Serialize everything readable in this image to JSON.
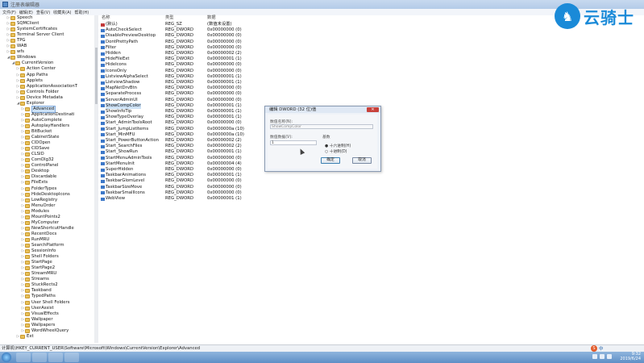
{
  "window": {
    "title": "注册表编辑器"
  },
  "menu": [
    "文件(F)",
    "编辑(E)",
    "查看(V)",
    "收藏夹(A)",
    "帮助(H)"
  ],
  "tree": {
    "items": [
      {
        "label": "Speech",
        "indent": 1,
        "expanded": false
      },
      {
        "label": "SQMClient",
        "indent": 1,
        "expanded": false
      },
      {
        "label": "SystemCertificates",
        "indent": 1,
        "expanded": false
      },
      {
        "label": "Terminal Server Client",
        "indent": 1,
        "expanded": false
      },
      {
        "label": "TPG",
        "indent": 1,
        "expanded": false
      },
      {
        "label": "WAB",
        "indent": 1,
        "expanded": false
      },
      {
        "label": "wfs",
        "indent": 1,
        "expanded": false
      },
      {
        "label": "Windows",
        "indent": 1,
        "expanded": true
      },
      {
        "label": "CurrentVersion",
        "indent": 2,
        "expanded": true
      },
      {
        "label": "Action Center",
        "indent": 3,
        "expanded": false
      },
      {
        "label": "App Paths",
        "indent": 3,
        "expanded": false
      },
      {
        "label": "Applets",
        "indent": 3,
        "expanded": false
      },
      {
        "label": "ApplicationAssociationT",
        "indent": 3,
        "expanded": false
      },
      {
        "label": "Controls Folder",
        "indent": 3,
        "expanded": false
      },
      {
        "label": "Device Metadata",
        "indent": 3,
        "expanded": false
      },
      {
        "label": "Explorer",
        "indent": 3,
        "expanded": true
      },
      {
        "label": "Advanced",
        "indent": 4,
        "expanded": false,
        "selected": true
      },
      {
        "label": "ApplicationDestinati",
        "indent": 4,
        "expanded": false
      },
      {
        "label": "AutoComplete",
        "indent": 4,
        "expanded": false
      },
      {
        "label": "AutoplayHandlers",
        "indent": 4,
        "expanded": false
      },
      {
        "label": "BitBucket",
        "indent": 4,
        "expanded": false
      },
      {
        "label": "CabinetState",
        "indent": 4,
        "expanded": false
      },
      {
        "label": "CIDOpen",
        "indent": 4,
        "expanded": false
      },
      {
        "label": "CIDSave",
        "indent": 4,
        "expanded": false
      },
      {
        "label": "CLSID",
        "indent": 4,
        "expanded": false
      },
      {
        "label": "ComDlg32",
        "indent": 4,
        "expanded": false
      },
      {
        "label": "ControlPanel",
        "indent": 4,
        "expanded": false
      },
      {
        "label": "Desktop",
        "indent": 4,
        "expanded": false
      },
      {
        "label": "Discardable",
        "indent": 4,
        "expanded": false
      },
      {
        "label": "FileExts",
        "indent": 4,
        "expanded": false
      },
      {
        "label": "FolderTypes",
        "indent": 4,
        "expanded": false
      },
      {
        "label": "HideDesktopIcons",
        "indent": 4,
        "expanded": false
      },
      {
        "label": "LowRegistry",
        "indent": 4,
        "expanded": false
      },
      {
        "label": "MenuOrder",
        "indent": 4,
        "expanded": false
      },
      {
        "label": "Modules",
        "indent": 4,
        "expanded": false
      },
      {
        "label": "MountPoints2",
        "indent": 4,
        "expanded": false
      },
      {
        "label": "MyComputer",
        "indent": 4,
        "expanded": false
      },
      {
        "label": "NewShortcutHandle",
        "indent": 4,
        "expanded": false
      },
      {
        "label": "RecentDocs",
        "indent": 4,
        "expanded": false
      },
      {
        "label": "RunMRU",
        "indent": 4,
        "expanded": false
      },
      {
        "label": "SearchPlatform",
        "indent": 4,
        "expanded": false
      },
      {
        "label": "SessionInfo",
        "indent": 4,
        "expanded": false
      },
      {
        "label": "Shell Folders",
        "indent": 4,
        "expanded": false
      },
      {
        "label": "StartPage",
        "indent": 4,
        "expanded": false
      },
      {
        "label": "StartPage2",
        "indent": 4,
        "expanded": false
      },
      {
        "label": "StreamMRU",
        "indent": 4,
        "expanded": false
      },
      {
        "label": "Streams",
        "indent": 4,
        "expanded": false
      },
      {
        "label": "StuckRects2",
        "indent": 4,
        "expanded": false
      },
      {
        "label": "Taskband",
        "indent": 4,
        "expanded": false
      },
      {
        "label": "TypedPaths",
        "indent": 4,
        "expanded": false
      },
      {
        "label": "User Shell Folders",
        "indent": 4,
        "expanded": false
      },
      {
        "label": "UserAssist",
        "indent": 4,
        "expanded": false
      },
      {
        "label": "VisualEffects",
        "indent": 4,
        "expanded": false
      },
      {
        "label": "Wallpaper",
        "indent": 4,
        "expanded": false
      },
      {
        "label": "Wallpapers",
        "indent": 4,
        "expanded": false
      },
      {
        "label": "WordWheelQuery",
        "indent": 4,
        "expanded": false
      },
      {
        "label": "Ext",
        "indent": 3,
        "expanded": false
      }
    ]
  },
  "values": {
    "headers": {
      "name": "名称",
      "type": "类型",
      "data": "数据"
    },
    "rows": [
      {
        "name": "(默认)",
        "type": "REG_SZ",
        "data": "(数值未设置)",
        "kind": "sz"
      },
      {
        "name": "AutoCheckSelect",
        "type": "REG_DWORD",
        "data": "0x00000000 (0)",
        "kind": "dword"
      },
      {
        "name": "DisablePreviewDesktop",
        "type": "REG_DWORD",
        "data": "0x00000000 (0)",
        "kind": "dword"
      },
      {
        "name": "DontPrettyPath",
        "type": "REG_DWORD",
        "data": "0x00000000 (0)",
        "kind": "dword"
      },
      {
        "name": "Filter",
        "type": "REG_DWORD",
        "data": "0x00000000 (0)",
        "kind": "dword"
      },
      {
        "name": "Hidden",
        "type": "REG_DWORD",
        "data": "0x00000002 (2)",
        "kind": "dword"
      },
      {
        "name": "HideFileExt",
        "type": "REG_DWORD",
        "data": "0x00000001 (1)",
        "kind": "dword"
      },
      {
        "name": "HideIcons",
        "type": "REG_DWORD",
        "data": "0x00000000 (0)",
        "kind": "dword"
      },
      {
        "name": "IconsOnly",
        "type": "REG_DWORD",
        "data": "0x00000000 (0)",
        "kind": "dword"
      },
      {
        "name": "ListviewAlphaSelect",
        "type": "REG_DWORD",
        "data": "0x00000001 (1)",
        "kind": "dword"
      },
      {
        "name": "ListviewShadow",
        "type": "REG_DWORD",
        "data": "0x00000001 (1)",
        "kind": "dword"
      },
      {
        "name": "MapNetDrvBtn",
        "type": "REG_DWORD",
        "data": "0x00000000 (0)",
        "kind": "dword"
      },
      {
        "name": "SeparateProcess",
        "type": "REG_DWORD",
        "data": "0x00000000 (0)",
        "kind": "dword"
      },
      {
        "name": "ServerAdminUI",
        "type": "REG_DWORD",
        "data": "0x00000000 (0)",
        "kind": "dword"
      },
      {
        "name": "ShowCompColor",
        "type": "REG_DWORD",
        "data": "0x00000001 (1)",
        "kind": "dword",
        "selected": true
      },
      {
        "name": "ShowInfoTip",
        "type": "REG_DWORD",
        "data": "0x00000001 (1)",
        "kind": "dword"
      },
      {
        "name": "ShowTypeOverlay",
        "type": "REG_DWORD",
        "data": "0x00000001 (1)",
        "kind": "dword"
      },
      {
        "name": "Start_AdminToolsRoot",
        "type": "REG_DWORD",
        "data": "0x00000000 (0)",
        "kind": "dword"
      },
      {
        "name": "Start_JumpListItems",
        "type": "REG_DWORD",
        "data": "0x0000000a (10)",
        "kind": "dword"
      },
      {
        "name": "Start_MinMFU",
        "type": "REG_DWORD",
        "data": "0x0000000a (10)",
        "kind": "dword"
      },
      {
        "name": "Start_PowerButtonAction",
        "type": "REG_DWORD",
        "data": "0x00000002 (2)",
        "kind": "dword"
      },
      {
        "name": "Start_SearchFiles",
        "type": "REG_DWORD",
        "data": "0x00000002 (2)",
        "kind": "dword"
      },
      {
        "name": "Start_ShowRun",
        "type": "REG_DWORD",
        "data": "0x00000001 (1)",
        "kind": "dword"
      },
      {
        "name": "StartMenuAdminTools",
        "type": "REG_DWORD",
        "data": "0x00000000 (0)",
        "kind": "dword"
      },
      {
        "name": "StartMenuInit",
        "type": "REG_DWORD",
        "data": "0x00000004 (4)",
        "kind": "dword"
      },
      {
        "name": "SuperHidden",
        "type": "REG_DWORD",
        "data": "0x00000000 (0)",
        "kind": "dword"
      },
      {
        "name": "TaskbarAnimations",
        "type": "REG_DWORD",
        "data": "0x00000001 (1)",
        "kind": "dword"
      },
      {
        "name": "TaskbarGlomLevel",
        "type": "REG_DWORD",
        "data": "0x00000000 (0)",
        "kind": "dword"
      },
      {
        "name": "TaskbarSizeMove",
        "type": "REG_DWORD",
        "data": "0x00000000 (0)",
        "kind": "dword"
      },
      {
        "name": "TaskbarSmallIcons",
        "type": "REG_DWORD",
        "data": "0x00000000 (0)",
        "kind": "dword"
      },
      {
        "name": "WebView",
        "type": "REG_DWORD",
        "data": "0x00000001 (1)",
        "kind": "dword"
      }
    ]
  },
  "dialog": {
    "title": "编辑 DWORD (32 位)值",
    "close": "✕",
    "name_label": "数值名称(N):",
    "name_value": "ShowCompColor",
    "data_label": "数值数据(V):",
    "data_value": "1",
    "base_label": "基数",
    "hex_label": "● 十六进制(H)",
    "dec_label": "○ 十进制(D)",
    "ok": "确定",
    "cancel": "取消"
  },
  "statusbar": {
    "path": "计算机\\HKEY_CURRENT_USER\\Software\\Microsoft\\Windows\\CurrentVersion\\Explorer\\Advanced"
  },
  "ime": {
    "label": "中",
    "badge": "S"
  },
  "tray": {
    "time": "9:32",
    "date": "2019/6/24"
  },
  "watermark": {
    "text": "云骑士"
  }
}
